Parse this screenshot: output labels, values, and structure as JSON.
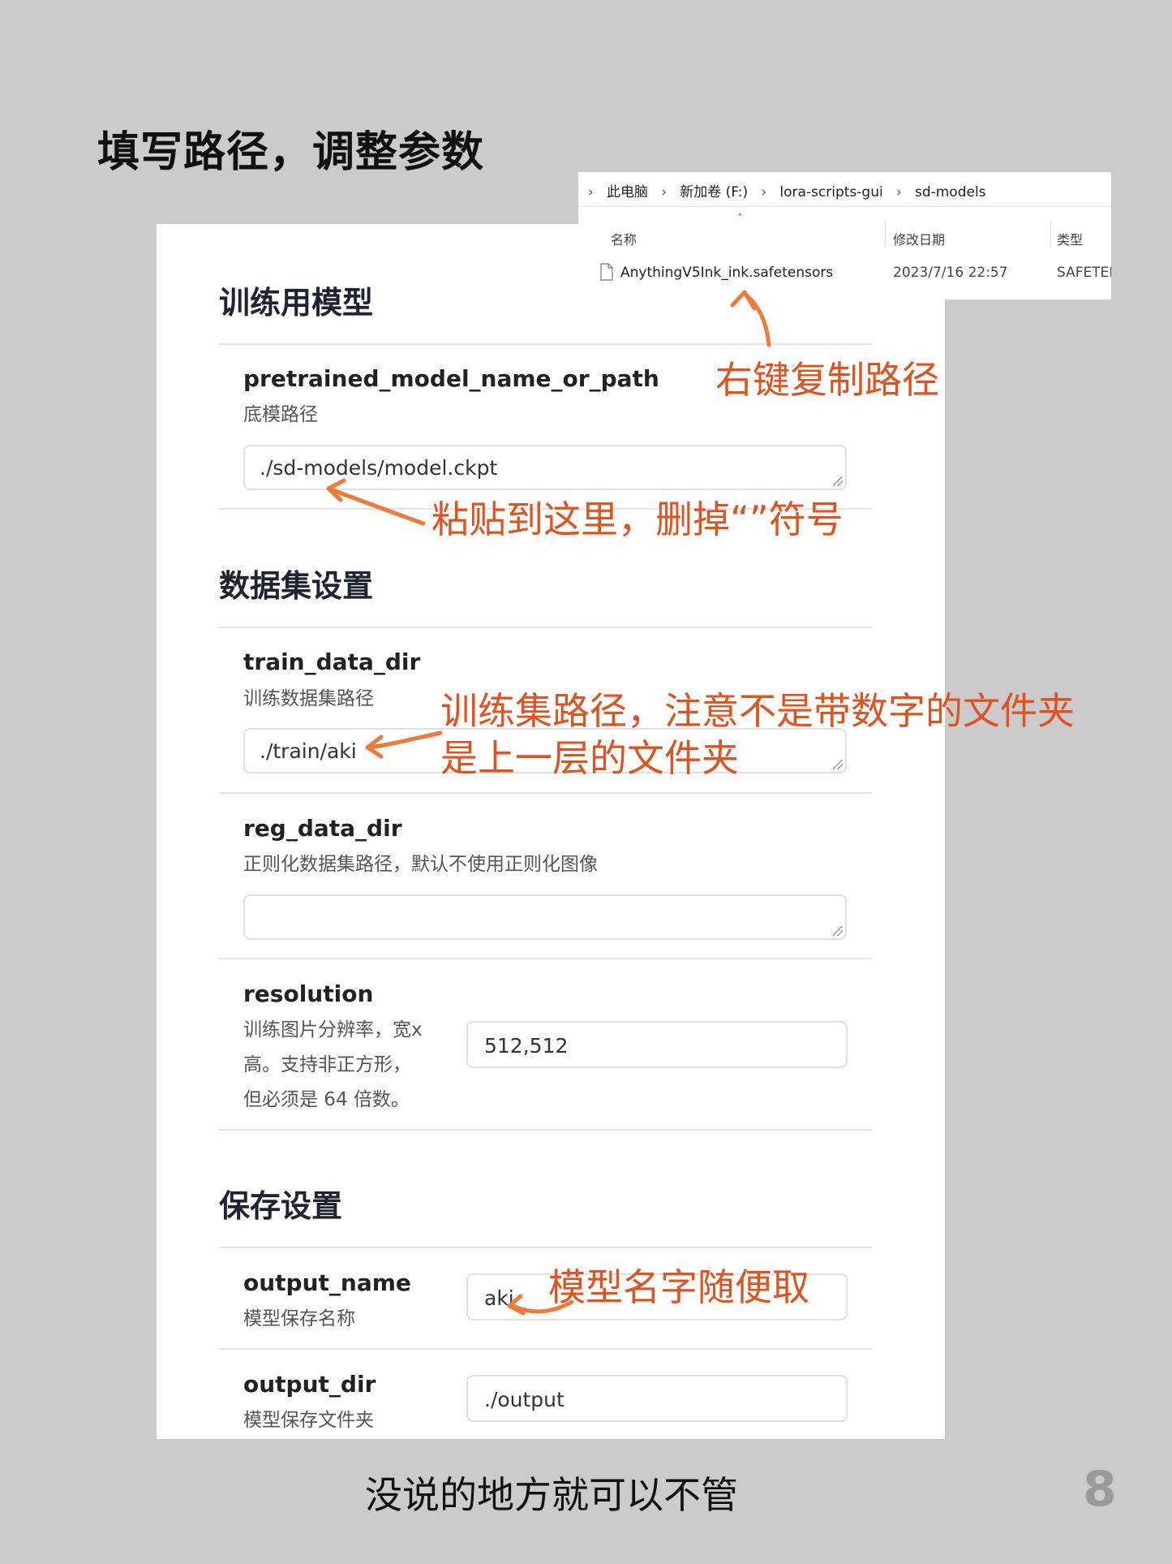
{
  "heading": "填写路径，调整参数",
  "explorer": {
    "breadcrumb": [
      "此电脑",
      "新加卷 (F:)",
      "lora-scripts-gui",
      "sd-models"
    ],
    "columns": {
      "name": "名称",
      "modified": "修改日期",
      "type": "类型"
    },
    "file": {
      "name": "AnythingV5Ink_ink.safetensors",
      "modified": "2023/7/16 22:57",
      "type": "SAFETEN"
    }
  },
  "sections": {
    "model": {
      "title": "训练用模型",
      "pretrained": {
        "name": "pretrained_model_name_or_path",
        "desc": "底模路径",
        "value": "./sd-models/model.ckpt"
      }
    },
    "dataset": {
      "title": "数据集设置",
      "train": {
        "name": "train_data_dir",
        "desc": "训练数据集路径",
        "value": "./train/aki"
      },
      "reg": {
        "name": "reg_data_dir",
        "desc": "正则化数据集路径，默认不使用正则化图像",
        "value": ""
      },
      "resolution": {
        "name": "resolution",
        "desc1": "训练图片分辨率，宽x",
        "desc2": "高。支持非正方形，",
        "desc3": "但必须是 64 倍数。",
        "value": "512,512"
      }
    },
    "save": {
      "title": "保存设置",
      "output_name": {
        "name": "output_name",
        "desc": "模型保存名称",
        "value": "aki"
      },
      "output_dir": {
        "name": "output_dir",
        "desc": "模型保存文件夹",
        "value": "./output"
      }
    }
  },
  "annotations": {
    "copy_path": "右键复制路径",
    "paste_here": "粘贴到这里，删掉“”符号",
    "train_line1": "训练集路径，注意不是带数字的文件夹",
    "train_line2": "是上一层的文件夹",
    "model_name": "模型名字随便取"
  },
  "footer": "没说的地方就可以不管",
  "page_number": "8",
  "accent_color": "#e0531e"
}
